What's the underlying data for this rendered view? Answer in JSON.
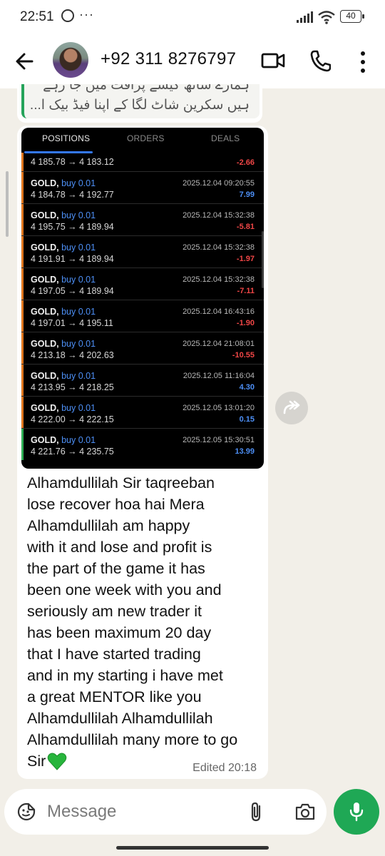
{
  "status_bar": {
    "time": "22:51",
    "battery": "40"
  },
  "header": {
    "contact": "+92 311 8276797"
  },
  "quoted": {
    "line1": "ہمارے ساتھ کیسے پرافٹ میں جا رہے",
    "line2": "ہیں سکرین شاٹ لگا کے اپنا فیڈ بیک ا..."
  },
  "screenshot": {
    "tabs": [
      "POSITIONS",
      "ORDERS",
      "DEALS"
    ],
    "first_row": {
      "prices": "4 185.78 → 4 183.12",
      "pl": "-2.66"
    },
    "deals": [
      {
        "symbol": "GOLD,",
        "dir": "buy 0.01",
        "prices": "4 184.78 → 4 192.77",
        "datetime": "2025.12.04 09:20:55",
        "pl": "7.99"
      },
      {
        "symbol": "GOLD,",
        "dir": "buy 0.01",
        "prices": "4 195.75 → 4 189.94",
        "datetime": "2025.12.04 15:32:38",
        "pl": "-5.81"
      },
      {
        "symbol": "GOLD,",
        "dir": "buy 0.01",
        "prices": "4 191.91 → 4 189.94",
        "datetime": "2025.12.04 15:32:38",
        "pl": "-1.97"
      },
      {
        "symbol": "GOLD,",
        "dir": "buy 0.01",
        "prices": "4 197.05 → 4 189.94",
        "datetime": "2025.12.04 15:32:38",
        "pl": "-7.11"
      },
      {
        "symbol": "GOLD,",
        "dir": "buy 0.01",
        "prices": "4 197.01 → 4 195.11",
        "datetime": "2025.12.04 16:43:16",
        "pl": "-1.90"
      },
      {
        "symbol": "GOLD,",
        "dir": "buy 0.01",
        "prices": "4 213.18 → 4 202.63",
        "datetime": "2025.12.04 21:08:01",
        "pl": "-10.55"
      },
      {
        "symbol": "GOLD,",
        "dir": "buy 0.01",
        "prices": "4 213.95 → 4 218.25",
        "datetime": "2025.12.05 11:16:04",
        "pl": "4.30"
      },
      {
        "symbol": "GOLD,",
        "dir": "buy 0.01",
        "prices": "4 222.00 → 4 222.15",
        "datetime": "2025.12.05 13:01:20",
        "pl": "0.15"
      },
      {
        "symbol": "GOLD,",
        "dir": "buy 0.01",
        "prices": "4 221.76 → 4 235.75",
        "datetime": "2025.12.05 15:30:51",
        "pl": "13.99"
      }
    ]
  },
  "message": {
    "lines": [
      "Alhamdullilah Sir taqreeban",
      "lose recover hoa hai Mera",
      "Alhamdullilah am happy",
      "with it and lose and profit is",
      "the part of the game it has",
      "been one week with you and",
      "seriously am new trader it",
      "has been maximum 20 day",
      "that I have started trading",
      "and in my starting i have met",
      "a great MENTOR like you",
      "Alhamdullilah Alhamdullilah",
      "Alhamdullilah many more to go",
      "Sir"
    ],
    "edited": "Edited 20:18"
  },
  "composer": {
    "placeholder": "Message"
  },
  "colors": {
    "accent": "#1fa855",
    "profit": "#4d8ff5",
    "loss": "#ef4646",
    "orange_marker": "#e0761e",
    "green_marker": "#2fae55"
  },
  "icons": [
    "back-arrow-icon",
    "video-call-icon",
    "phone-icon",
    "more-vert-icon",
    "forward-icon",
    "emoji-icon",
    "attach-icon",
    "camera-icon",
    "mic-icon",
    "green-heart-icon"
  ]
}
